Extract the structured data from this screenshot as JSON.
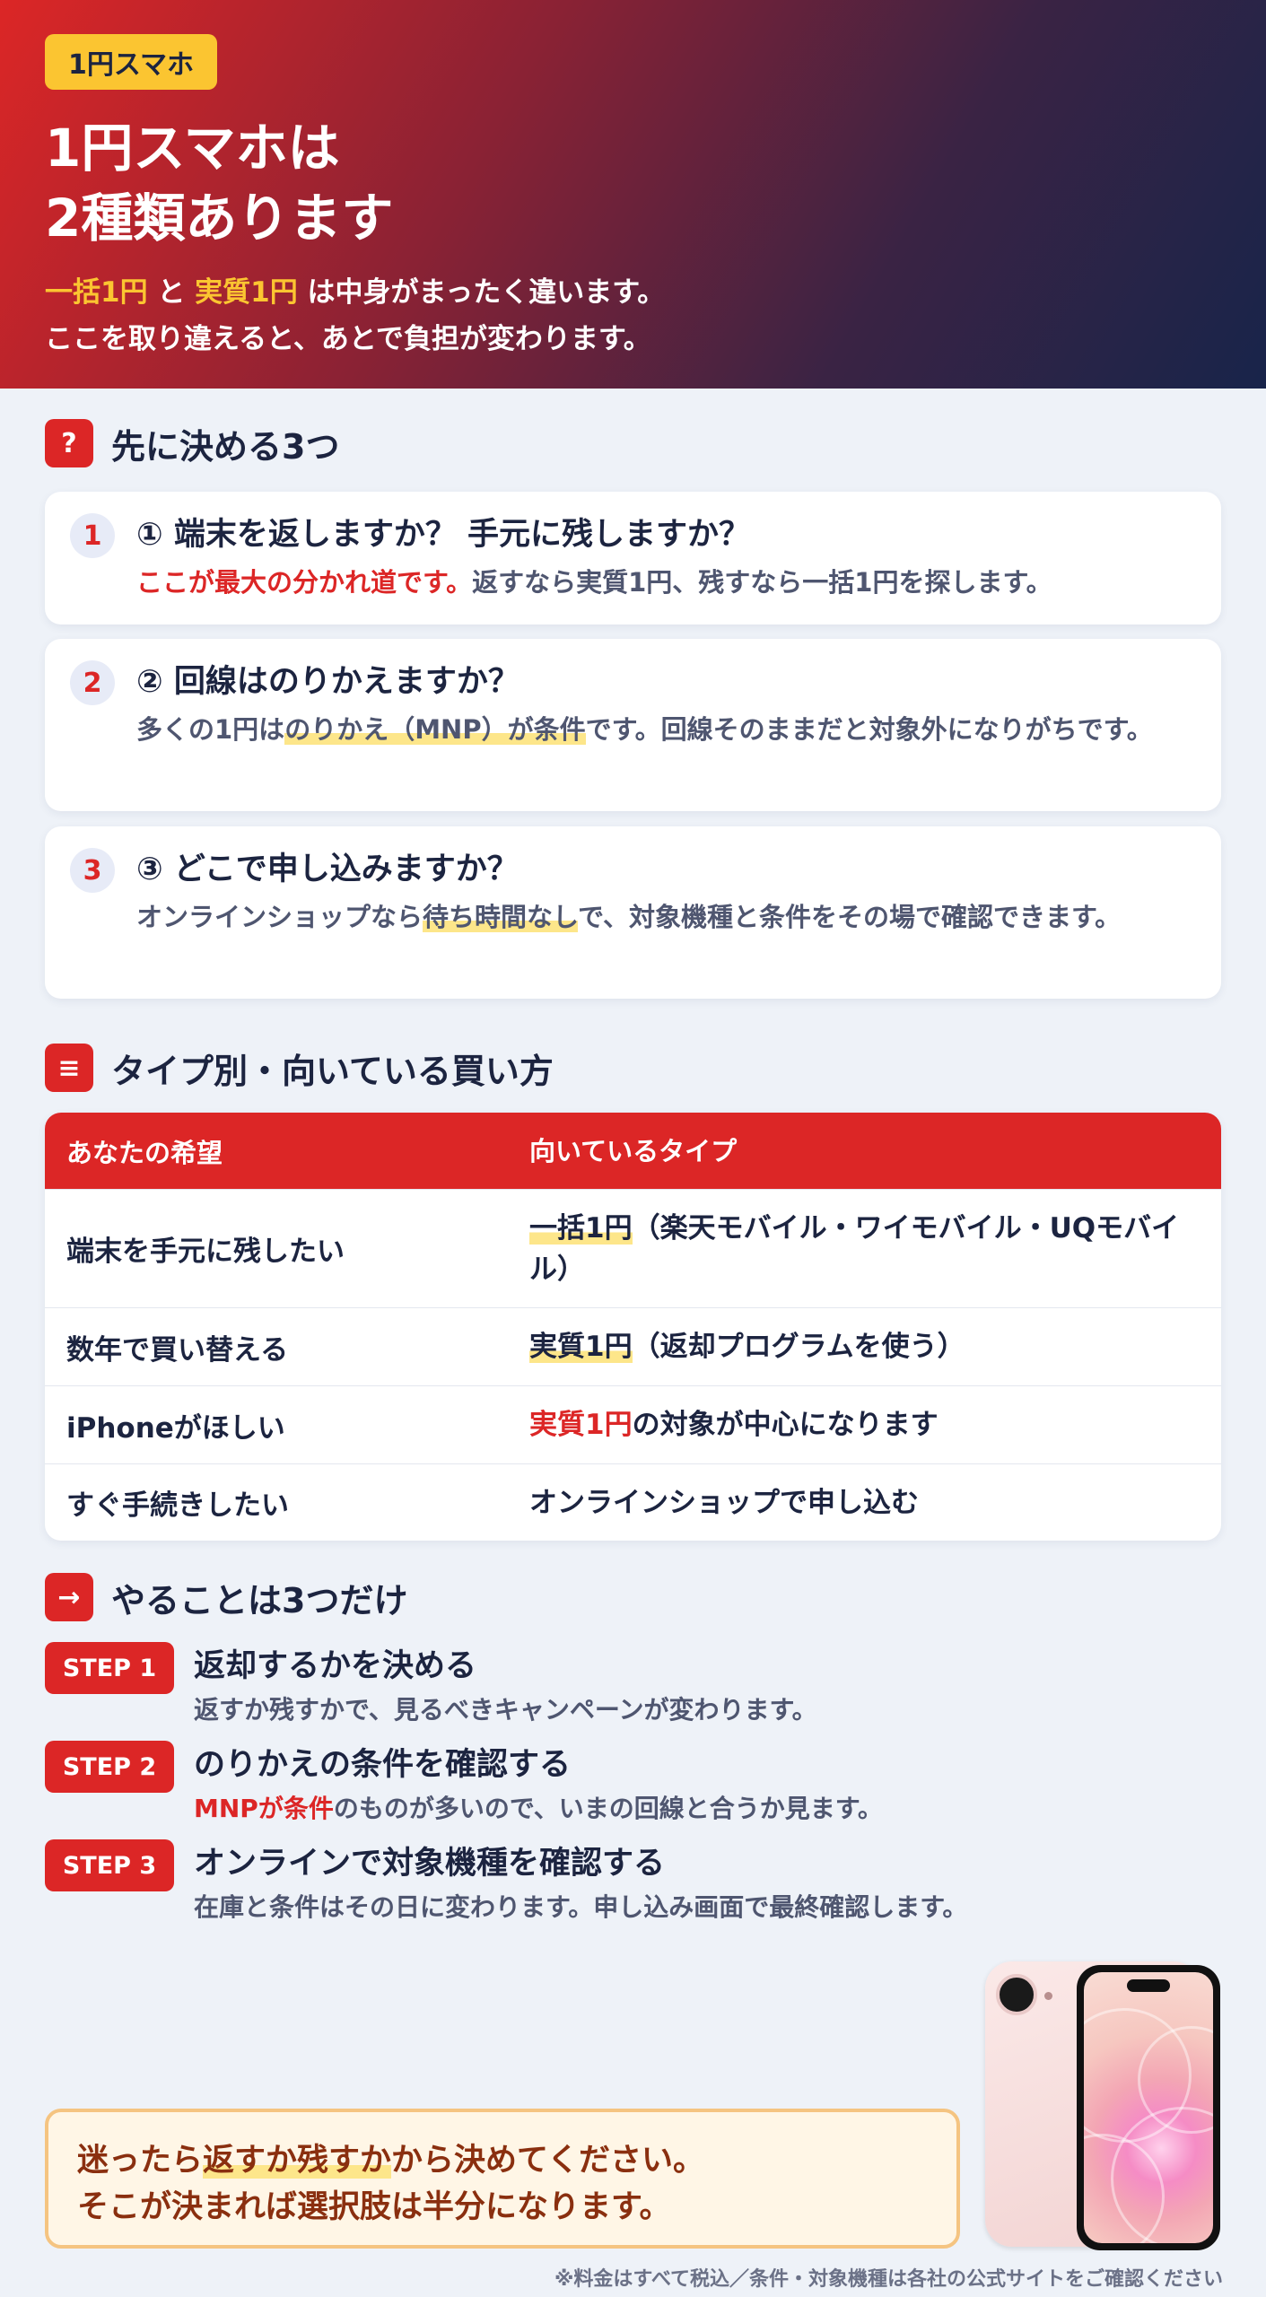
{
  "hero": {
    "badge": "1円スマホ",
    "title_line1": "1円スマホは",
    "title_line2": "2種類あります",
    "sub_part1": "一括1円",
    "sub_part2": "と",
    "sub_part3": "実質1円",
    "sub_part4": "は中身がまったく違います。",
    "sub_line2": "ここを取り違えると、あとで負担が変わります。"
  },
  "section1": {
    "icon": "?",
    "title": "先に決める3つ"
  },
  "questions": [
    {
      "num": "1",
      "title": "① 端末を返しますか？ 手元に残しますか？",
      "body_red": "ここが最大の分かれ道です。",
      "body_rest": "返すなら実質1円、残すなら一括1円を探します。"
    },
    {
      "num": "2",
      "title": "② 回線はのりかえますか？",
      "body_pre": "多くの1円は",
      "body_hl": "のりかえ（MNP）が条件",
      "body_post": "です。回線そのままだと対象外になりがちです。"
    },
    {
      "num": "3",
      "title": "③ どこで申し込みますか？",
      "body_pre": "オンラインショップなら",
      "body_hl": "待ち時間なし",
      "body_post": "で、対象機種と条件をその場で確認できます。"
    }
  ],
  "section2": {
    "icon": "≡",
    "title": "タイプ別・向いている買い方"
  },
  "table": {
    "headers": [
      "あなたの希望",
      "向いているタイプ"
    ],
    "rows": [
      {
        "wish": "端末を手元に残したい",
        "type_hl": "一括1円",
        "type_rest": "（楽天モバイル・ワイモバイル・UQモバイル）"
      },
      {
        "wish": "数年で買い替える",
        "type_hl": "実質1円",
        "type_rest": "（返却プログラムを使う）"
      },
      {
        "wish": "iPhoneがほしい",
        "type_red": "実質1円",
        "type_rest": "の対象が中心になります"
      },
      {
        "wish": "すぐ手続きしたい",
        "type_rest": "オンラインショップで申し込む"
      }
    ]
  },
  "section3": {
    "icon": "→",
    "title": "やることは3つだけ"
  },
  "steps": [
    {
      "badge": "STEP 1",
      "title": "返却するかを決める",
      "desc": "返すか残すかで、見るべきキャンペーンが変わります。"
    },
    {
      "badge": "STEP 2",
      "title": "のりかえの条件を確認する",
      "desc_red": "MNPが条件",
      "desc": "のものが多いので、いまの回線と合うか見ます。"
    },
    {
      "badge": "STEP 3",
      "title": "オンラインで対象機種を確認する",
      "desc": "在庫と条件はその日に変わります。申し込み画面で最終確認します。"
    }
  ],
  "callout": {
    "line1_pre": "迷ったら",
    "line1_hl": "返すか残すか",
    "line1_post": "から決めてください。",
    "line2": "そこが決まれば選択肢は半分になります。"
  },
  "footnote": "※料金はすべて税込／条件・対象機種は各社の公式サイトをご確認ください",
  "colors": {
    "accent_red": "#dc2626",
    "badge_yellow": "#fbc531",
    "navy": "#1c2440"
  }
}
